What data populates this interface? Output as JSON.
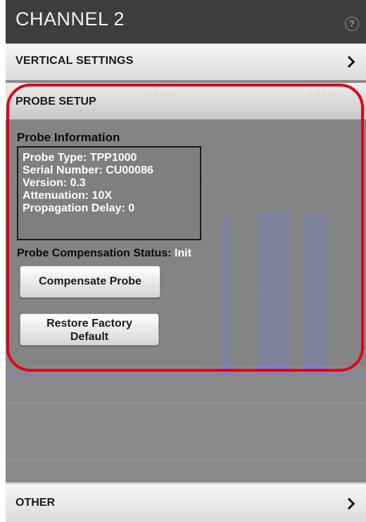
{
  "header": {
    "title": "CHANNEL 2",
    "help_icon": "?"
  },
  "vertical_settings": {
    "label": "VERTICAL SETTINGS",
    "icon": "chevron-right-icon"
  },
  "probe_setup": {
    "label": "PROBE SETUP",
    "time_labels": [
      "-3.52 µs",
      "-2.64 µs"
    ],
    "probe_information_title": "Probe Information",
    "info_lines": [
      "Probe Type: TPP1000",
      "Serial Number: CU00086",
      "Version: 0.3",
      "Attenuation: 10X",
      "Propagation Delay: 0"
    ],
    "compensation_status_label": "Probe Compensation Status:",
    "compensation_status_value": "Init",
    "compensate_button": "Compensate Probe",
    "restore_button_line1": "Restore Factory",
    "restore_button_line2": "Default"
  },
  "other": {
    "label": "OTHER",
    "icon": "chevron-right-icon"
  },
  "colors": {
    "highlight": "#e2001a",
    "header_bg": "#3d3d3d",
    "waveform": "#7a80c8"
  }
}
